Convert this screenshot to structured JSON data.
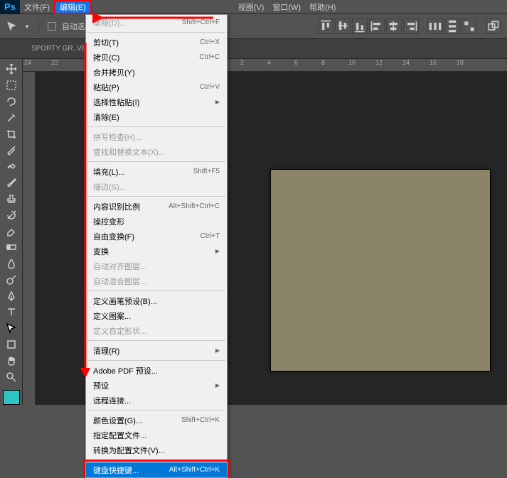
{
  "menubar": {
    "logo": "Ps",
    "items": [
      "文件(F)",
      "编辑(E)",
      "",
      "",
      "",
      "",
      "视图(V)",
      "窗口(W)",
      "帮助(H)"
    ]
  },
  "toolbar": {
    "auto_select": "自动选择："
  },
  "doc": {
    "tab": "SPORTY GR..VERNI"
  },
  "ruler": [
    "24",
    "22",
    "",
    "",
    "",
    "",
    "",
    "",
    "2",
    "4",
    "6",
    "8",
    "10",
    "12",
    "14",
    "16",
    "18"
  ],
  "dropdown": [
    {
      "label": "渐隐(D)...",
      "shortcut": "Shift+Ctrl+F",
      "disabled": true
    },
    {
      "sep": true
    },
    {
      "label": "剪切(T)",
      "shortcut": "Ctrl+X"
    },
    {
      "label": "拷贝(C)",
      "shortcut": "Ctrl+C"
    },
    {
      "label": "合并拷贝(Y)",
      "shortcut": ""
    },
    {
      "label": "粘贴(P)",
      "shortcut": "Ctrl+V"
    },
    {
      "label": "选择性粘贴(I)",
      "shortcut": "",
      "sub": true
    },
    {
      "label": "清除(E)",
      "shortcut": ""
    },
    {
      "sep": true
    },
    {
      "label": "拼写检查(H)...",
      "shortcut": "",
      "disabled": true
    },
    {
      "label": "查找和替换文本(X)...",
      "shortcut": "",
      "disabled": true
    },
    {
      "sep": true
    },
    {
      "label": "填充(L)...",
      "shortcut": "Shift+F5"
    },
    {
      "label": "描边(S)...",
      "shortcut": "",
      "disabled": true
    },
    {
      "sep": true
    },
    {
      "label": "内容识别比例",
      "shortcut": "Alt+Shift+Ctrl+C"
    },
    {
      "label": "操控变形",
      "shortcut": ""
    },
    {
      "label": "自由变换(F)",
      "shortcut": "Ctrl+T"
    },
    {
      "label": "变换",
      "shortcut": "",
      "sub": true
    },
    {
      "label": "自动对齐图层...",
      "shortcut": "",
      "disabled": true
    },
    {
      "label": "自动混合图层...",
      "shortcut": "",
      "disabled": true
    },
    {
      "sep": true
    },
    {
      "label": "定义画笔预设(B)...",
      "shortcut": ""
    },
    {
      "label": "定义图案...",
      "shortcut": ""
    },
    {
      "label": "定义自定形状...",
      "shortcut": "",
      "disabled": true
    },
    {
      "sep": true
    },
    {
      "label": "清理(R)",
      "shortcut": "",
      "sub": true
    },
    {
      "sep": true
    },
    {
      "label": "Adobe PDF 预设...",
      "shortcut": ""
    },
    {
      "label": "预设",
      "shortcut": "",
      "sub": true
    },
    {
      "label": "远程连接...",
      "shortcut": ""
    },
    {
      "sep": true
    },
    {
      "label": "颜色设置(G)...",
      "shortcut": "Shift+Ctrl+K"
    },
    {
      "label": "指定配置文件...",
      "shortcut": ""
    },
    {
      "label": "转换为配置文件(V)...",
      "shortcut": ""
    },
    {
      "sep": true
    },
    {
      "label": "键盘快捷键...",
      "shortcut": "Alt+Shift+Ctrl+K",
      "highlighted": true
    }
  ]
}
